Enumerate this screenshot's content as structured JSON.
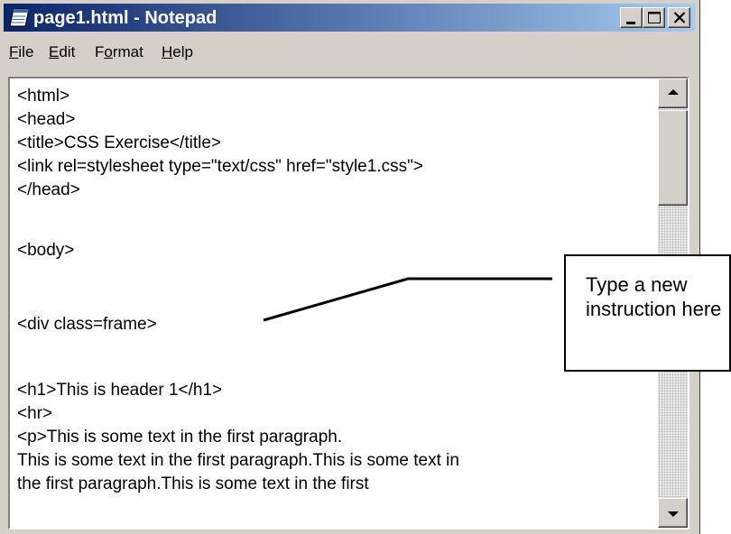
{
  "window": {
    "title": "page1.html - Notepad",
    "icon": "notepad-icon"
  },
  "title_buttons": {
    "minimize": "minimize-icon",
    "maximize": "maximize-icon",
    "close": "close-icon"
  },
  "menu": {
    "items": [
      {
        "accel": "F",
        "rest": "ile"
      },
      {
        "accel": "E",
        "rest": "dit"
      },
      {
        "pre": "F",
        "accel": "o",
        "rest": "rmat"
      },
      {
        "accel": "H",
        "rest": "elp"
      }
    ]
  },
  "editor": {
    "lines": [
      "<html>",
      "<head>",
      "<title>CSS Exercise</title>",
      "<link rel=stylesheet type=\"text/css\" href=\"style1.css\">",
      "</head>",
      "",
      "<body>",
      "",
      "<div class=frame>",
      "",
      "<h1>This is header 1</h1>",
      "<hr>",
      "<p>This is some text in the first paragraph.",
      "This is some text in the first paragraph.This is some text in",
      "the first paragraph.This is some text in the first"
    ]
  },
  "callout": {
    "text": "Type a new instruction here"
  },
  "colors": {
    "title_start": "#0a246a",
    "title_end": "#a6caf0",
    "face": "#d4d0c8"
  }
}
